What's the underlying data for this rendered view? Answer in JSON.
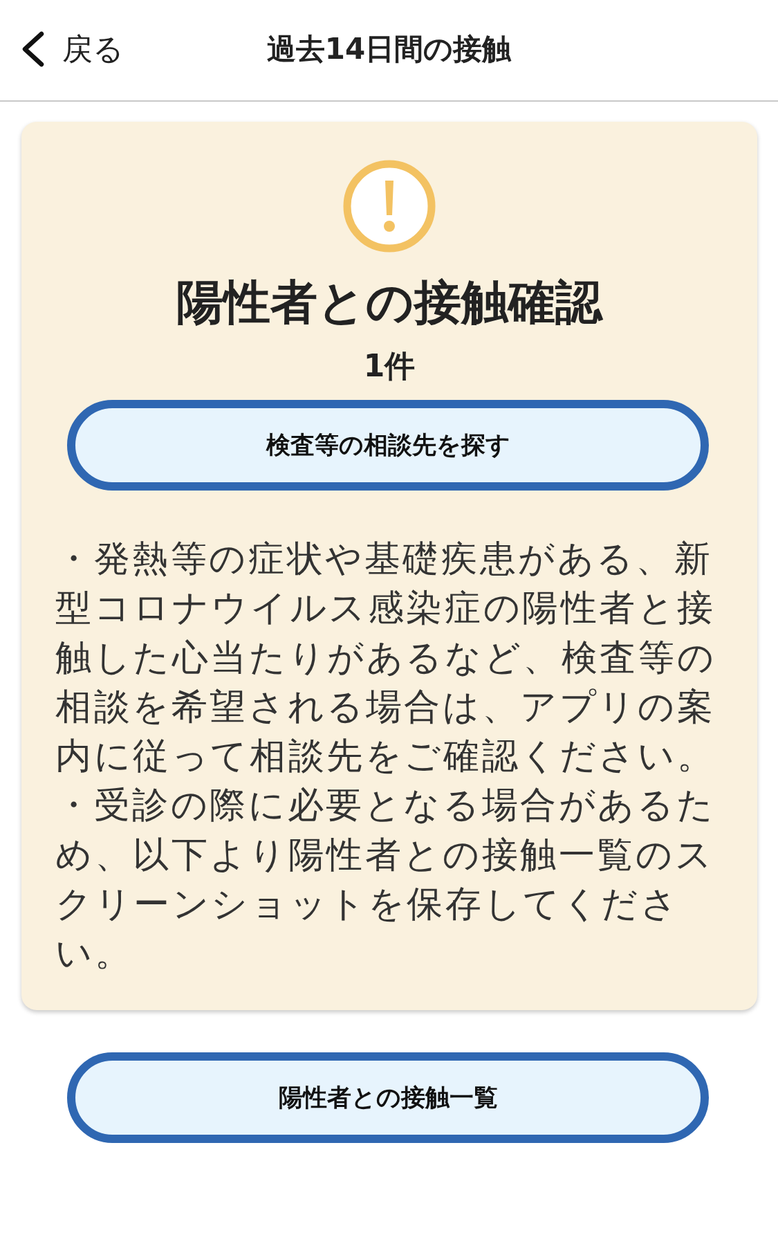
{
  "header": {
    "back_label": "戻る",
    "title": "過去14日間の接触"
  },
  "alert_card": {
    "title": "陽性者との接触確認",
    "count": "1件",
    "consult_button": "検査等の相談先を探す",
    "notes": [
      "・発熱等の症状や基礎疾患がある、新型コロナウイルス感染症の陽性者と接触した心当たりがあるなど、検査等の相談を希望される場合は、アプリの案内に従って相談先をご確認ください。",
      "・受診の際に必要となる場合があるため、以下より陽性者との接触一覧のスクリーンショットを保存してください。"
    ]
  },
  "contacts_button": "陽性者との接触一覧"
}
